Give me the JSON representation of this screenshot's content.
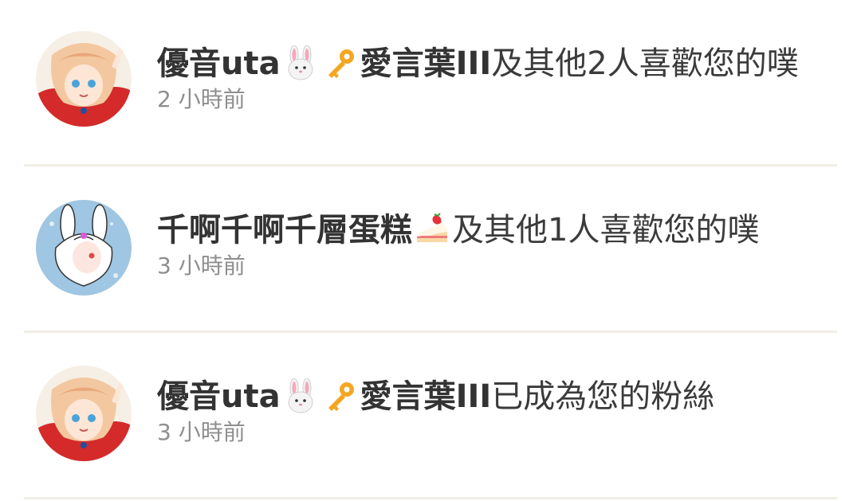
{
  "notifications": [
    {
      "avatar_style": "red-hair-anime",
      "user_name": "優音uta",
      "user_emojis": [
        "rabbit-face",
        "key"
      ],
      "user_name_suffix": "愛言葉III",
      "action_text": "及其他2人喜歡您的噗",
      "time": "2 小時前"
    },
    {
      "avatar_style": "blue-bunny-anime",
      "user_name": "千啊千啊千層蛋糕",
      "user_emojis": [
        "shortcake"
      ],
      "user_name_suffix": "",
      "action_text": "及其他1人喜歡您的噗",
      "time": "3 小時前"
    },
    {
      "avatar_style": "red-hair-anime",
      "user_name": "優音uta",
      "user_emojis": [
        "rabbit-face",
        "key"
      ],
      "user_name_suffix": "愛言葉III",
      "action_text": "已成為您的粉絲",
      "time": "3 小時前"
    }
  ],
  "colors": {
    "title_text": "#333333",
    "time_text": "#8e8e8e",
    "divider": "#f1ece6",
    "background": "#ffffff"
  }
}
